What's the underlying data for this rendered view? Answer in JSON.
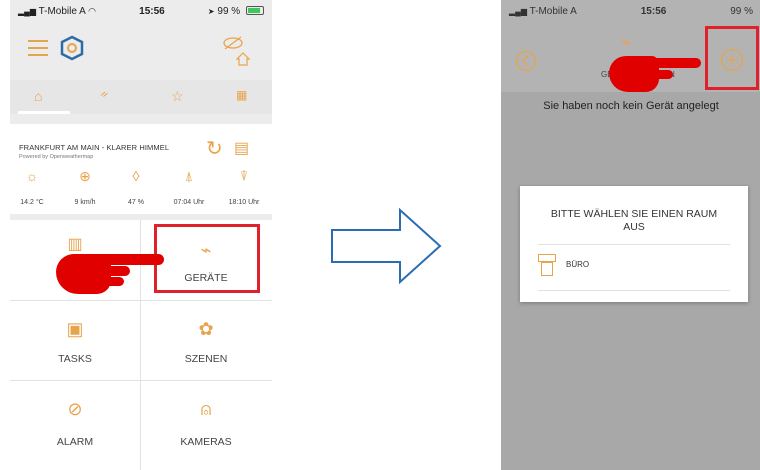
{
  "left_screen": {
    "status": {
      "carrier": "T-Mobile A",
      "time": "15:56",
      "battery": "99 %"
    },
    "weather": {
      "location": "FRANKFURT AM MAIN - KLARER HIMMEL",
      "powered_by": "Powered by Openweathermap",
      "values": [
        "14.2 °C",
        "9 km/h",
        "47 %",
        "07:04 Uhr",
        "18:10 Uhr"
      ]
    },
    "tiles": {
      "geraete": "GERÄTE",
      "tasks": "TASKS",
      "szenen": "SZENEN",
      "alarm": "ALARM",
      "kameras": "KAMERAS"
    }
  },
  "right_screen": {
    "status": {
      "carrier": "T-Mobile A",
      "time": "15:56",
      "battery": "99 %"
    },
    "header_fragment_left": "GE",
    "header_fragment_right": "N",
    "empty_message": "Sie haben noch kein Gerät angelegt",
    "dialog": {
      "title": "BITTE WÄHLEN SIE EINEN RAUM AUS",
      "room": "BÜRO"
    }
  },
  "colors": {
    "accent": "#e8a44c",
    "highlight": "#e0202a",
    "arrow": "#2a6db5"
  },
  "icons": [
    "menu-icon",
    "logo-icon",
    "eye-off-icon",
    "home-icon",
    "refresh-icon",
    "calendar-icon",
    "plug-icon",
    "back-icon",
    "add-icon",
    "room-icon"
  ]
}
